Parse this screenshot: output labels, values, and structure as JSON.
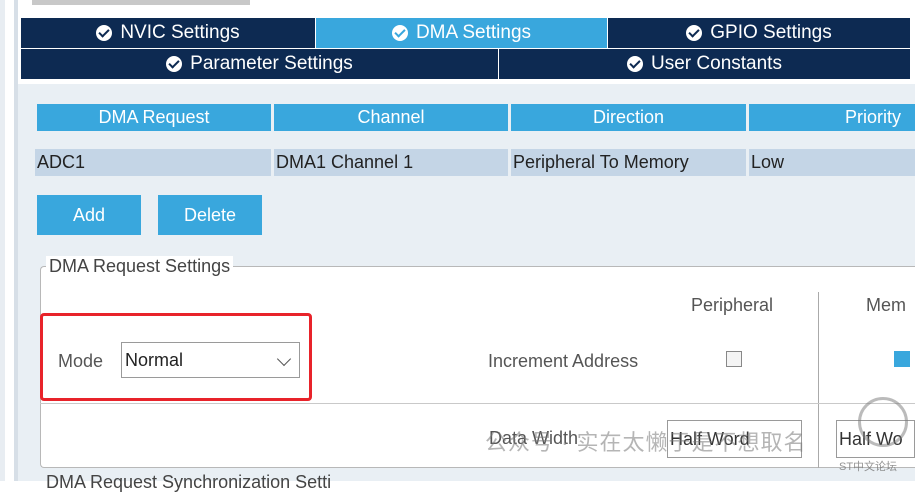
{
  "tabs_row1": [
    {
      "label": "NVIC Settings",
      "active": false
    },
    {
      "label": "DMA Settings",
      "active": true
    },
    {
      "label": "GPIO Settings",
      "active": false
    }
  ],
  "tabs_row2": [
    {
      "label": "Parameter Settings"
    },
    {
      "label": "User Constants"
    }
  ],
  "table": {
    "headers": [
      "DMA Request",
      "Channel",
      "Direction",
      "Priority"
    ],
    "rows": [
      [
        "ADC1",
        "DMA1 Channel 1",
        "Peripheral To Memory",
        "Low"
      ]
    ]
  },
  "buttons": {
    "add": "Add",
    "delete": "Delete"
  },
  "settings": {
    "legend": "DMA Request Settings",
    "mode_label": "Mode",
    "mode_value": "Normal",
    "col_peripheral": "Peripheral",
    "col_memory": "Mem",
    "increment_label": "Increment Address",
    "data_width_label": "Data Width",
    "peripheral_width": "Half Word",
    "memory_width": "Half Wo"
  },
  "bottom_legend": "DMA Request Synchronization Setti",
  "watermark": {
    "text": "公众号 · 实在太懒于是不想取名",
    "sub": "ST中文论坛"
  },
  "colors": {
    "tab_active": "#39a7dd",
    "tab_inactive": "#0d2a52",
    "highlight": "#e8232a",
    "row_selected": "#c4d5e6"
  }
}
